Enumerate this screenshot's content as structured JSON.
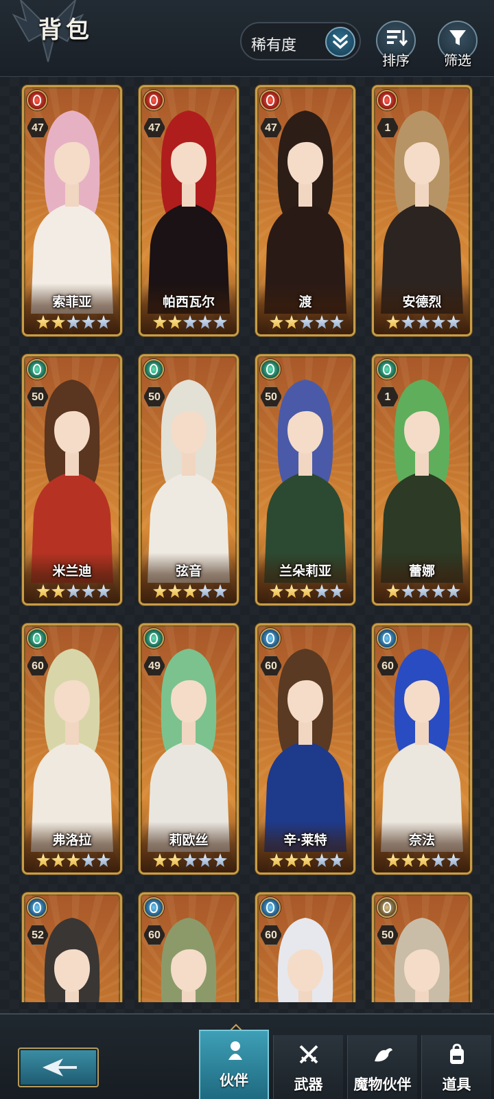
{
  "header": {
    "title": "背包",
    "sort_value": "稀有度",
    "sort_label": "排序",
    "filter_label": "筛选"
  },
  "colors": {
    "card_border": "#c99d47",
    "active_tab": "#3e9fb6",
    "star_gold": "#e9b33e",
    "star_silver": "#8fa8c9"
  },
  "cards": [
    {
      "name": "索菲亚",
      "level": "47",
      "element": "fire",
      "stars": 2,
      "hair": "#e7b1c4",
      "outfit": "#f2ece4"
    },
    {
      "name": "帕西瓦尔",
      "level": "47",
      "element": "fire",
      "stars": 2,
      "hair": "#b01d1d",
      "outfit": "#1a1214"
    },
    {
      "name": "渡",
      "level": "47",
      "element": "fire",
      "stars": 2,
      "hair": "#2c1d16",
      "outfit": "#2a1a16"
    },
    {
      "name": "安德烈",
      "level": "1",
      "element": "fire",
      "stars": 1,
      "hair": "#b79465",
      "outfit": "#2c2420"
    },
    {
      "name": "米兰迪",
      "level": "50",
      "element": "wind",
      "stars": 2,
      "hair": "#5a3520",
      "outfit": "#b63324"
    },
    {
      "name": "弦音",
      "level": "50",
      "element": "wind",
      "stars": 3,
      "hair": "#e3e0d6",
      "outfit": "#eeeae2"
    },
    {
      "name": "兰朵莉亚",
      "level": "50",
      "element": "wind",
      "stars": 3,
      "hair": "#4a5aa8",
      "outfit": "#2c4a32"
    },
    {
      "name": "蕾娜",
      "level": "1",
      "element": "wind",
      "stars": 1,
      "hair": "#5fae5c",
      "outfit": "#2c3a26"
    },
    {
      "name": "弗洛拉",
      "level": "60",
      "element": "wind",
      "stars": 3,
      "hair": "#d8d6a8",
      "outfit": "#efe9df"
    },
    {
      "name": "莉欧丝",
      "level": "49",
      "element": "wind",
      "stars": 2,
      "hair": "#7cc28e",
      "outfit": "#e9e6e0"
    },
    {
      "name": "辛·莱特",
      "level": "60",
      "element": "water",
      "stars": 3,
      "hair": "#5a3a22",
      "outfit": "#1e3a8a"
    },
    {
      "name": "奈法",
      "level": "60",
      "element": "water",
      "stars": 3,
      "hair": "#2a4cc2",
      "outfit": "#ebe6de"
    },
    {
      "name": "",
      "level": "52",
      "element": "water",
      "stars": 0,
      "hair": "#3a3634",
      "outfit": "#1c1a1a"
    },
    {
      "name": "",
      "level": "60",
      "element": "water",
      "stars": 0,
      "hair": "#8c9a6a",
      "outfit": "#e8e4da"
    },
    {
      "name": "",
      "level": "60",
      "element": "water",
      "stars": 0,
      "hair": "#e6e8ee",
      "outfit": "#dfe2ea"
    },
    {
      "name": "",
      "level": "50",
      "element": "earth",
      "stars": 0,
      "hair": "#c9bda8",
      "outfit": "#3a3028"
    }
  ],
  "tabs": [
    {
      "label": "伙伴",
      "icon": "partner-icon",
      "active": true
    },
    {
      "label": "武器",
      "icon": "crossed-swords-icon",
      "active": false
    },
    {
      "label": "魔物伙伴",
      "icon": "dragon-icon",
      "active": false
    },
    {
      "label": "道具",
      "icon": "backpack-icon",
      "active": false
    }
  ]
}
